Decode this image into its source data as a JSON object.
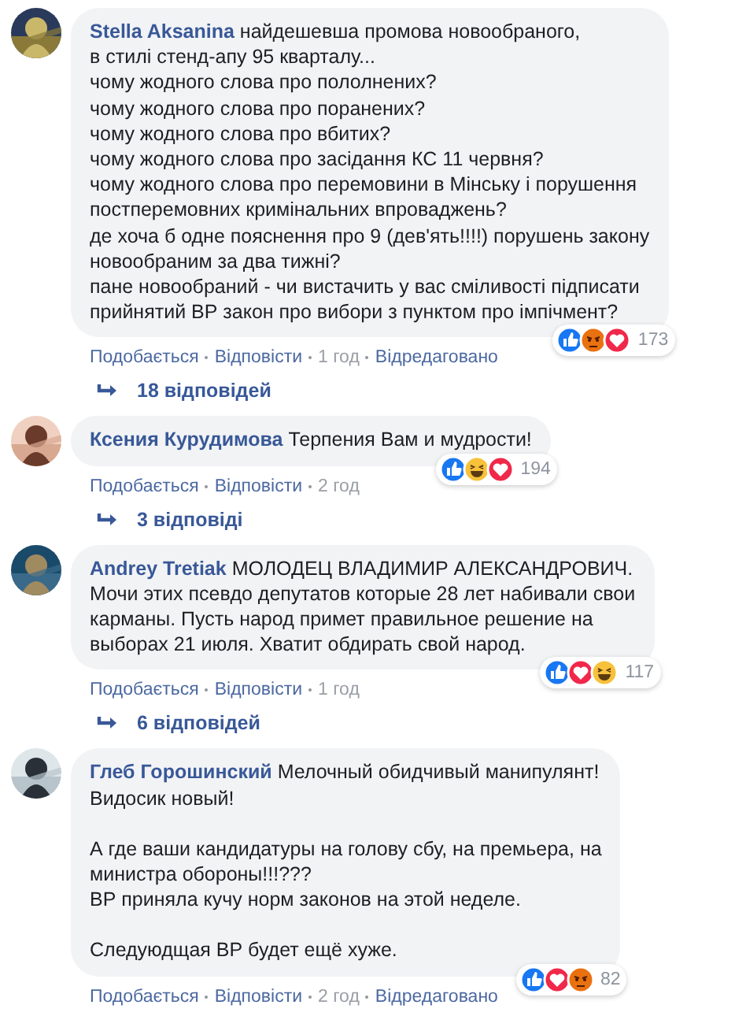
{
  "comments": [
    {
      "author": "Stella Aksanina",
      "paragraphs": [
        [
          "найдешевша промова новообраного,",
          "в стилі стенд-апу 95 кварталу...",
          "чому жодного слова про пололнених?",
          "чому жодного слова про поранених?",
          "чому жодного слова про вбитих?",
          "чому жодного слова про засідання КС 11 червня?",
          "чому жодного слова про перемовини в Мінську і порушення",
          "постперемовних кримінальних впроваджень?",
          "де хоча б одне пояснення про 9 (дев'ять!!!!) порушень закону",
          "новообраним за два тижні?",
          "пане новообраний - чи вистачить у вас сміливості підписати",
          "прийнятий ВР закон про вибори з пунктом про імпічмент?"
        ]
      ],
      "reactions": {
        "icons": [
          {
            "kind": "like"
          },
          {
            "kind": "angry"
          },
          {
            "kind": "love"
          }
        ],
        "count": "173"
      },
      "actions": [
        {
          "kind": "link",
          "label": "Подобається"
        },
        {
          "kind": "link",
          "label": "Відповісти"
        },
        {
          "kind": "time",
          "label": "1 год"
        },
        {
          "kind": "link",
          "label": "Відредаговано"
        }
      ],
      "replies": "18 відповідей"
    },
    {
      "author": "Ксения Курудимова",
      "paragraphs": [
        [
          "Терпения Вам и мудрости!"
        ]
      ],
      "reactions": {
        "icons": [
          {
            "kind": "like"
          },
          {
            "kind": "haha"
          },
          {
            "kind": "love"
          }
        ],
        "count": "194"
      },
      "actions": [
        {
          "kind": "link",
          "label": "Подобається"
        },
        {
          "kind": "link",
          "label": "Відповісти"
        },
        {
          "kind": "time",
          "label": "2 год"
        }
      ],
      "replies": "3 відповіді"
    },
    {
      "author": "Andrey Tretiak",
      "paragraphs": [
        [
          "МОЛОДЕЦ ВЛАДИМИР АЛЕКСАНДРОВИЧ.",
          "Мочи этих псевдо депутатов которые 28 лет набивали свои",
          "карманы. Пусть народ примет правильное решение на",
          "выборах 21 июля. Хватит обдирать свой народ."
        ]
      ],
      "reactions": {
        "icons": [
          {
            "kind": "like"
          },
          {
            "kind": "love"
          },
          {
            "kind": "haha"
          }
        ],
        "count": "117"
      },
      "actions": [
        {
          "kind": "link",
          "label": "Подобається"
        },
        {
          "kind": "link",
          "label": "Відповісти"
        },
        {
          "kind": "time",
          "label": "1 год"
        }
      ],
      "replies": "6 відповідей"
    },
    {
      "author": "Глеб Горошинский",
      "paragraphs": [
        [
          "Мелочный обидчивый манипулянт!",
          "Видосик новый!"
        ],
        [
          "А где ваши кандидатуры на голову сбу, на премьера, на",
          "министра обороны!!!???",
          "ВР приняла кучу норм законов на этой неделе."
        ],
        [
          "Следуюдщая ВР будет ещё хуже."
        ]
      ],
      "reactions": {
        "icons": [
          {
            "kind": "like"
          },
          {
            "kind": "love"
          },
          {
            "kind": "angry"
          }
        ],
        "count": "82"
      },
      "actions": [
        {
          "kind": "link",
          "label": "Подобається"
        },
        {
          "kind": "link",
          "label": "Відповісти"
        },
        {
          "kind": "time",
          "label": "2 год"
        },
        {
          "kind": "link",
          "label": "Відредаговано"
        }
      ]
    }
  ]
}
